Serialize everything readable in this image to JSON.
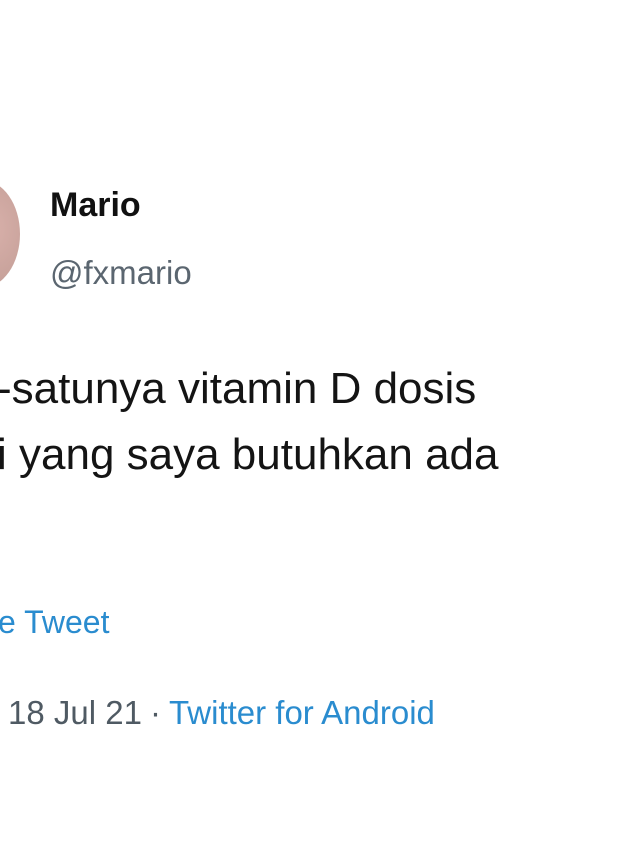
{
  "author": {
    "display_name": "Mario",
    "handle": "@fxmario"
  },
  "tweet": {
    "lines": [
      "-satunya vitamin D dosis",
      "i yang saya butuhkan ada"
    ]
  },
  "translate_link": "e Tweet",
  "meta": {
    "date": "18 Jul 21",
    "separator": "·",
    "source": "Twitter for Android"
  },
  "colors": {
    "link": "#2a8ccf",
    "secondary_text": "#5b6670",
    "avatar": "#c9a39c"
  },
  "icons": {
    "avatar": "user-avatar"
  }
}
